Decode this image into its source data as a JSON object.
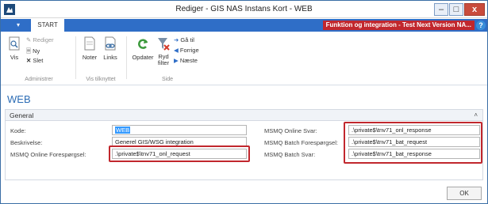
{
  "window": {
    "title": "Rediger - GIS NAS Instans Kort - WEB",
    "minimize": "–",
    "maximize": "□",
    "close": "x"
  },
  "ribbon_tabs": {
    "menu": "▾",
    "start": "START",
    "company": "Funktion og integration - Test Next Version NA...",
    "help": "?"
  },
  "ribbon": {
    "administrer": {
      "label": "Administrer",
      "vis": "Vis",
      "rediger": "Rediger",
      "ny": "Ny",
      "slet": "Slet"
    },
    "vis_tilknyttet": {
      "label": "Vis tilknyttet",
      "noter": "Noter",
      "links": "Links"
    },
    "side": {
      "label": "Side",
      "opdater": "Opdater",
      "ryd_filter_1": "Ryd",
      "ryd_filter_2": "filter",
      "ga_til": "Gå til",
      "forrige": "Forrige",
      "naeste": "Næste"
    }
  },
  "page_title": "WEB",
  "fasttab": {
    "title": "General",
    "collapse": "˄"
  },
  "fields": {
    "kode": {
      "label": "Kode:",
      "value": "WEB"
    },
    "beskrivelse": {
      "label": "Beskrivelse:",
      "value": "Generel GIS/WSG integration"
    },
    "online_foresp": {
      "label": "MSMQ Online Forespørgsel:",
      "value": ".\\private$\\tnv71_onl_request"
    },
    "online_svar": {
      "label": "MSMQ Online Svar:",
      "value": ".\\private$\\tnv71_onl_response"
    },
    "batch_foresp": {
      "label": "MSMQ Batch Forespørgsel:",
      "value": ".\\private$\\tnv71_bat_request"
    },
    "batch_svar": {
      "label": "MSMQ Batch Svar:",
      "value": ".\\private$\\tnv71_bat_response"
    }
  },
  "footer": {
    "ok": "OK"
  },
  "colors": {
    "accent": "#2f6ec7",
    "highlight": "#c1272d",
    "title_blue": "#2d6db5"
  }
}
